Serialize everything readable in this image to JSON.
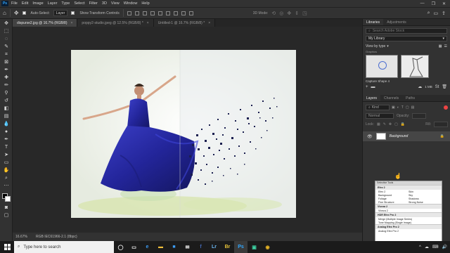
{
  "menubar": {
    "logo": "Ps",
    "items": [
      "File",
      "Edit",
      "Image",
      "Layer",
      "Type",
      "Select",
      "Filter",
      "3D",
      "View",
      "Window",
      "Help"
    ],
    "window_buttons": [
      "—",
      "❐",
      "✕"
    ]
  },
  "options_bar": {
    "auto_select_label": "Auto-Select:",
    "auto_select_value": "Layer",
    "transform_label": "Show Transform Controls",
    "mode_3d_label": "3D Mode:"
  },
  "tabs": [
    {
      "label": "dispurse2.jpg @ 16.7% (RGB/8)",
      "active": true
    },
    {
      "label": "poppy2-studio.jpeg @ 12.5% (RGB/8) *",
      "active": false
    },
    {
      "label": "Untitled-1 @ 16.7% (RGB/8) *",
      "active": false
    }
  ],
  "status_bar": {
    "zoom": "16.67%",
    "info": "RGB IEC61966-2.1 (8bpc)"
  },
  "libraries_panel": {
    "tabs": [
      "Libraries",
      "Adjustments"
    ],
    "search_placeholder": "Search Adobe Stock",
    "library_name": "My Library",
    "view_by_label": "View by type",
    "group_label": "Graphics",
    "item_caption": "Capture Shape 4",
    "size_label": "1 MB"
  },
  "layers_panel": {
    "tabs": [
      "Layers",
      "Channels",
      "Paths"
    ],
    "kind_filter": "Kind",
    "blend_mode": "Normal",
    "opacity_label": "Opacity:",
    "lock_label": "Lock:",
    "fill_label": "Fill:",
    "layer_name": "Background"
  },
  "plugin_panel": {
    "title": "Selective Tools",
    "sections": [
      {
        "name": "Efex 2",
        "rows": [
          [
            "Efex 2",
            "Skin"
          ],
          [
            "Background",
            "Sky"
          ],
          [
            "Foliage",
            "Shadows"
          ],
          [
            "Fine Structure",
            "Strong Noise"
          ]
        ]
      },
      {
        "name": "Viveza 2",
        "rows": [
          [
            "Viveza 2",
            ""
          ]
        ]
      },
      {
        "name": "HDR Efex Pro 2",
        "rows": [
          [
            "Merge (Multiple Image Series)",
            ""
          ],
          [
            "Tone Mapping (Single Image)",
            ""
          ]
        ]
      },
      {
        "name": "Analog Efex Pro 2",
        "rows": [
          [
            "Analog Efex Pro 2",
            ""
          ]
        ]
      }
    ]
  },
  "taskbar": {
    "search_placeholder": "Type here to search",
    "apps": [
      {
        "icon": "cortana-icon",
        "glyph": "◯",
        "color": "#ffffff"
      },
      {
        "icon": "task-view-icon",
        "glyph": "▭",
        "color": "#ffffff"
      },
      {
        "icon": "edge-icon",
        "glyph": "e",
        "color": "#3c9df5"
      },
      {
        "icon": "file-explorer-icon",
        "glyph": "▬",
        "color": "#f3c03b"
      },
      {
        "icon": "store-icon",
        "glyph": "■",
        "color": "#3c9df5"
      },
      {
        "icon": "mail-icon",
        "glyph": "✉",
        "color": "#ffffff"
      },
      {
        "icon": "facebook-icon",
        "glyph": "f",
        "color": "#4267b2"
      },
      {
        "icon": "lightroom-icon",
        "glyph": "Lr",
        "color": "#6bb6f0"
      },
      {
        "icon": "bridge-icon",
        "glyph": "Br",
        "color": "#e8c43a"
      },
      {
        "icon": "photoshop-icon",
        "glyph": "Ps",
        "color": "#31a8ff"
      },
      {
        "icon": "capture-icon",
        "glyph": "▣",
        "color": "#3ccfa1"
      },
      {
        "icon": "chrome-icon",
        "glyph": "◉",
        "color": "#e6b325"
      }
    ],
    "tray_icons": [
      "^",
      "☁",
      "⌨",
      "🔊"
    ]
  }
}
